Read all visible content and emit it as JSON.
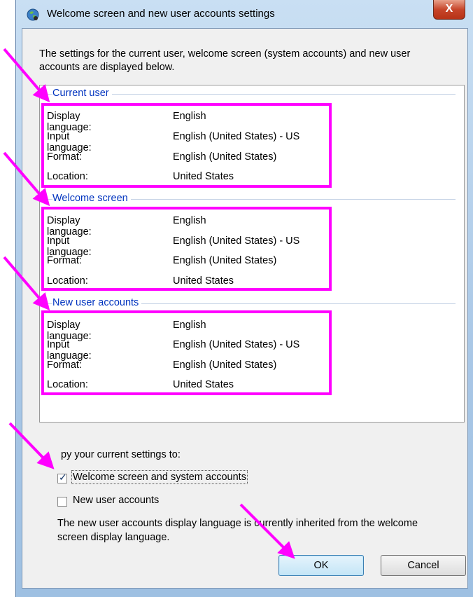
{
  "window": {
    "title": "Welcome screen and new user accounts settings",
    "close_label": "X"
  },
  "intro": "The settings for the current user, welcome screen (system accounts) and new user accounts are displayed below.",
  "groups": [
    {
      "title": "Current user",
      "rows": [
        {
          "label": "Display language:",
          "value": "English"
        },
        {
          "label": "Input language:",
          "value": "English (United States) - US"
        },
        {
          "label": "Format:",
          "value": "English (United States)"
        },
        {
          "label": "Location:",
          "value": "United States"
        }
      ]
    },
    {
      "title": "Welcome screen",
      "rows": [
        {
          "label": "Display language:",
          "value": "English"
        },
        {
          "label": "Input language:",
          "value": "English (United States) - US"
        },
        {
          "label": "Format:",
          "value": "English (United States)"
        },
        {
          "label": "Location:",
          "value": "United States"
        }
      ]
    },
    {
      "title": "New user accounts",
      "rows": [
        {
          "label": "Display language:",
          "value": "English"
        },
        {
          "label": "Input language:",
          "value": "English (United States) - US"
        },
        {
          "label": "Format:",
          "value": "English (United States)"
        },
        {
          "label": "Location:",
          "value": "United States"
        }
      ]
    }
  ],
  "copy": {
    "label": "py your current settings to:",
    "welcome_label": "Welcome screen and system accounts",
    "welcome_checked": true,
    "new_users_label": "New user accounts",
    "new_users_checked": false
  },
  "note": "The new user accounts display language is currently inherited from the welcome screen display language.",
  "buttons": {
    "ok": "OK",
    "cancel": "Cancel"
  },
  "highlight_color": "#ff00ff"
}
